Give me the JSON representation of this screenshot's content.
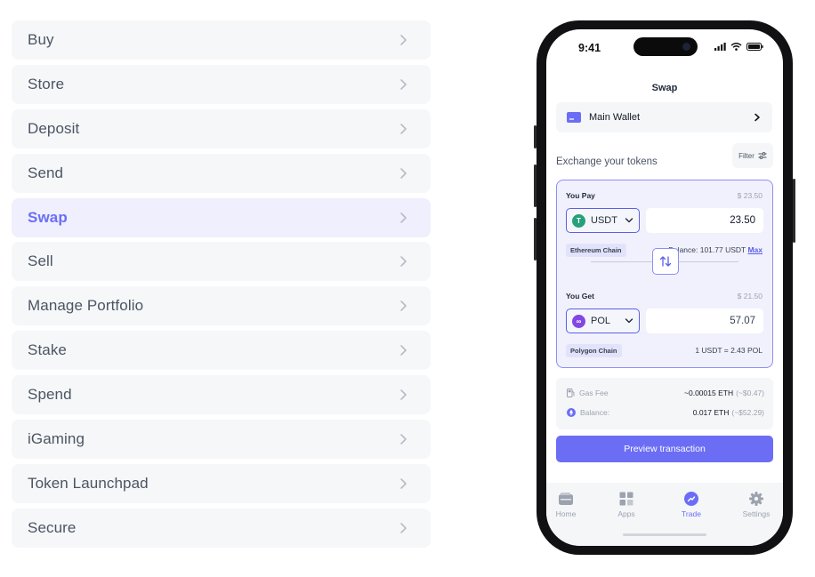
{
  "menu": {
    "items": [
      {
        "label": "Buy"
      },
      {
        "label": "Store"
      },
      {
        "label": "Deposit"
      },
      {
        "label": "Send"
      },
      {
        "label": "Swap",
        "active": true
      },
      {
        "label": "Sell"
      },
      {
        "label": "Manage Portfolio"
      },
      {
        "label": "Stake"
      },
      {
        "label": "Spend"
      },
      {
        "label": "iGaming"
      },
      {
        "label": "Token Launchpad"
      },
      {
        "label": "Secure"
      }
    ]
  },
  "phone": {
    "status": {
      "time": "9:41"
    },
    "title": "Swap",
    "wallet": {
      "label": "Main Wallet"
    },
    "exchange_label": "Exchange your tokens",
    "filter_label": "Filter",
    "pay": {
      "label": "You Pay",
      "usd": "$ 23.50",
      "token": "USDT",
      "token_icon": "tether-icon",
      "amount": "23.50",
      "chain": "Ethereum Chain",
      "balance": "Balance: 101.77 USDT",
      "max": "Max"
    },
    "get": {
      "label": "You Get",
      "usd": "$ 21.50",
      "token": "POL",
      "token_icon": "polygon-icon",
      "amount": "57.07",
      "chain": "Polygon Chain",
      "rate": "1 USDT = 2.43 POL"
    },
    "fees": {
      "gas_label": "Gas Fee",
      "gas_value": "~0.00015 ETH",
      "gas_usd": "(~$0.47)",
      "balance_label": "Balance:",
      "balance_value": "0.017 ETH",
      "balance_usd": "(~$52.29)"
    },
    "preview_button": "Preview transaction",
    "tabs": [
      {
        "label": "Home",
        "icon": "wallet-icon"
      },
      {
        "label": "Apps",
        "icon": "apps-grid-icon"
      },
      {
        "label": "Trade",
        "icon": "trade-icon",
        "active": true
      },
      {
        "label": "Settings",
        "icon": "gear-icon"
      }
    ]
  },
  "colors": {
    "accent": "#6b6ef5",
    "menu_bg": "#f6f7f9",
    "menu_active_bg": "#efeffd",
    "tether": "#26a17b",
    "polygon": "#8247e5"
  }
}
